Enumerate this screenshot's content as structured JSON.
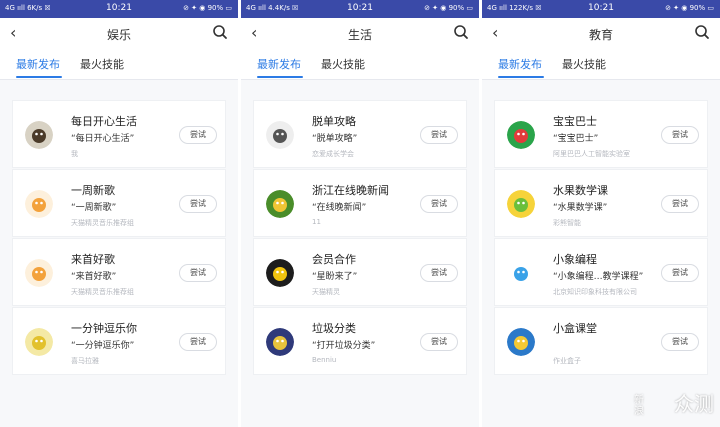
{
  "screens": [
    {
      "status": {
        "left": "4G ııll  6K/s  ☒",
        "time": "10:21",
        "right": "⊘ ✦ ◉ 90% ▭"
      },
      "title": "娱乐",
      "tabs": [
        "最新发布",
        "最火技能"
      ],
      "items": [
        {
          "name": "每日开心生活",
          "quote": "“每日开心生活”",
          "sub": "我",
          "button": "尝试",
          "avatar_colors": [
            "#d8d2c4",
            "#4b3b2a"
          ]
        },
        {
          "name": "一周新歌",
          "quote": "“一周新歌”",
          "sub": "天猫精灵音乐推荐组",
          "button": "尝试",
          "avatar_colors": [
            "#fdf0dc",
            "#f3a23c"
          ]
        },
        {
          "name": "来首好歌",
          "quote": "“来首好歌”",
          "sub": "天猫精灵音乐推荐组",
          "button": "尝试",
          "avatar_colors": [
            "#fdf0dc",
            "#f3a23c"
          ]
        },
        {
          "name": "一分钟逗乐你",
          "quote": "“一分钟逗乐你”",
          "sub": "喜马拉雅",
          "button": "尝试",
          "avatar_colors": [
            "#f4e9a5",
            "#e2c12c"
          ]
        }
      ]
    },
    {
      "status": {
        "left": "4G ııll  4.4K/s  ☒",
        "time": "10:21",
        "right": "⊘ ✦ ◉ 90% ▭"
      },
      "title": "生活",
      "tabs": [
        "最新发布",
        "最火技能"
      ],
      "items": [
        {
          "name": "脱单攻略",
          "quote": "“脱单攻略”",
          "sub": "恋爱成长学会",
          "button": "尝试",
          "avatar_colors": [
            "#eeeeee",
            "#555555"
          ]
        },
        {
          "name": "浙江在线晚新闻",
          "quote": "“在线晚新闻”",
          "sub": "11",
          "button": "尝试",
          "avatar_colors": [
            "#4a8d2a",
            "#f0c534"
          ]
        },
        {
          "name": "会员合作",
          "quote": "“星盼来了”",
          "sub": "天猫精灵",
          "button": "尝试",
          "avatar_colors": [
            "#1d1d1d",
            "#f1c40f"
          ]
        },
        {
          "name": "垃圾分类",
          "quote": "“打开垃圾分类”",
          "sub": "Benniu",
          "button": "尝试",
          "avatar_colors": [
            "#2f3a7a",
            "#e7c33c"
          ]
        }
      ]
    },
    {
      "status": {
        "left": "4G ııll  122K/s  ☒",
        "time": "10:21",
        "right": "⊘ ✦ ◉ 90% ▭"
      },
      "title": "教育",
      "tabs": [
        "最新发布",
        "最火技能"
      ],
      "items": [
        {
          "name": "宝宝巴士",
          "quote": "“宝宝巴士”",
          "sub": "阿里巴巴人工智能实验室",
          "button": "尝试",
          "avatar_colors": [
            "#2aa44a",
            "#e23b3b"
          ]
        },
        {
          "name": "水果数学课",
          "quote": "“水果数学课”",
          "sub": "彩熊智能",
          "button": "尝试",
          "avatar_colors": [
            "#f6d33a",
            "#6bbf3b"
          ]
        },
        {
          "name": "小象编程",
          "quote": "“小象编程…教学课程”",
          "sub": "北京知识印象科技有限公司",
          "button": "尝试",
          "avatar_colors": [
            "#ffffff",
            "#3aa2e8"
          ]
        },
        {
          "name": "小盒课堂",
          "quote": "",
          "sub": "作业盒子",
          "button": "尝试",
          "avatar_colors": [
            "#2b79c9",
            "#f4c935"
          ]
        }
      ]
    }
  ],
  "watermark": {
    "mark": "新\n浪",
    "text": "众测"
  },
  "colors": {
    "status_bar": "#3a4aa8",
    "accent": "#2c7be5"
  }
}
